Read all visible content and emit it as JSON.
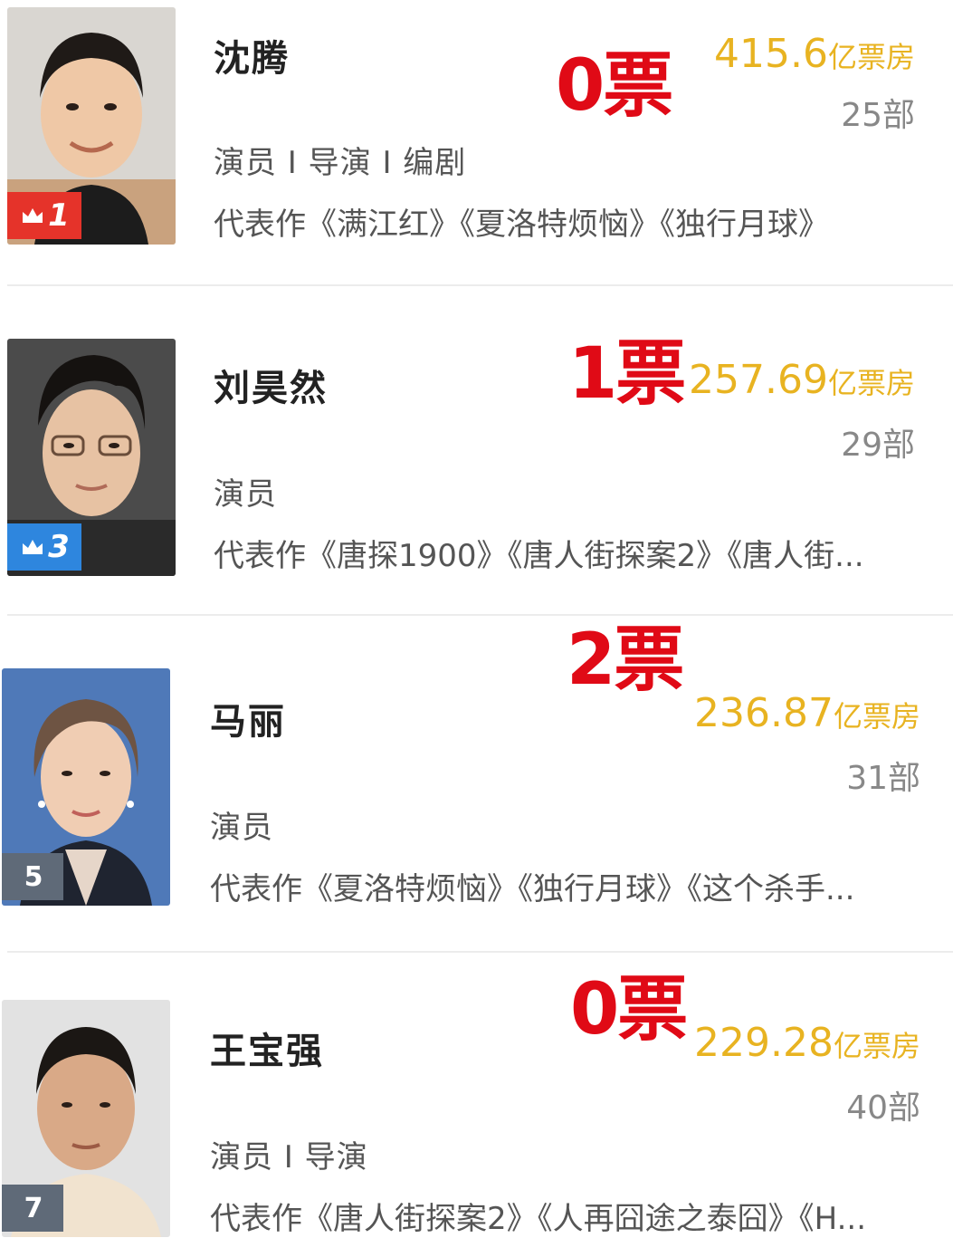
{
  "actors": [
    {
      "name": "沈腾",
      "rank": "1",
      "votes": "0票",
      "box_office_value": "415.6",
      "box_office_unit": "亿票房",
      "movie_count": "25部",
      "roles": "演员 I 导演 I 编剧",
      "works": "代表作《满江红》《夏洛特烦恼》《独行月球》"
    },
    {
      "name": "刘昊然",
      "rank": "3",
      "votes": "1票",
      "box_office_value": "257.69",
      "box_office_unit": "亿票房",
      "movie_count": "29部",
      "roles": "演员",
      "works": "代表作《唐探1900》《唐人街探案2》《唐人街..."
    },
    {
      "name": "马丽",
      "rank": "5",
      "votes": "2票",
      "box_office_value": "236.87",
      "box_office_unit": "亿票房",
      "movie_count": "31部",
      "roles": "演员",
      "works": "代表作《夏洛特烦恼》《独行月球》《这个杀手..."
    },
    {
      "name": "王宝强",
      "rank": "7",
      "votes": "0票",
      "box_office_value": "229.28",
      "box_office_unit": "亿票房",
      "movie_count": "40部",
      "roles": "演员 I 导演",
      "works": "代表作《唐人街探案2》《人再囧途之泰囧》《H..."
    }
  ],
  "icons": {
    "crown": "crown-icon"
  },
  "colors": {
    "votes_red": "#e00a16",
    "box_office_gold": "#e8b321",
    "rank1_badge": "#e5332a",
    "rank3_badge": "#2e86de",
    "rank_other_badge": "#5f6a78"
  }
}
